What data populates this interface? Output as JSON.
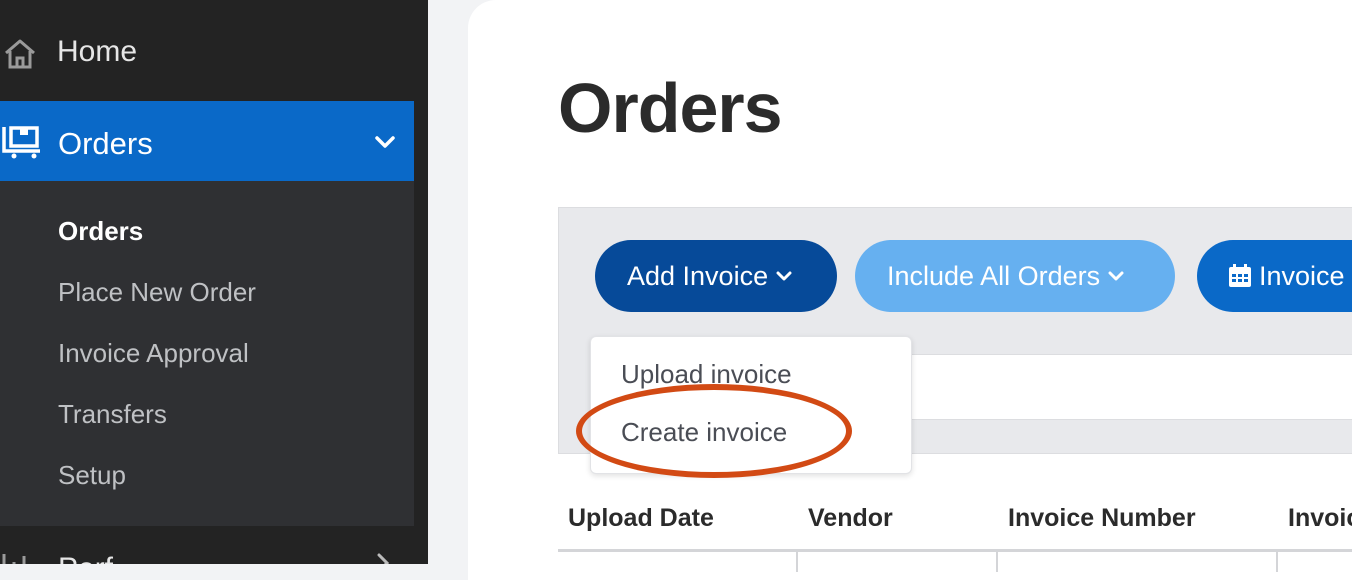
{
  "sidebar": {
    "home_label": "Home",
    "orders_label": "Orders",
    "sub_items": [
      "Orders",
      "Place New Order",
      "Invoice Approval",
      "Transfers",
      "Setup"
    ],
    "next_label": "Perf",
    "active_color": "#0a69c8"
  },
  "main": {
    "title": "Orders",
    "toolbar": {
      "add_invoice": "Add Invoice",
      "include_all_orders": "Include All Orders",
      "invoice_date": "Invoice"
    },
    "dropdown": {
      "items": [
        "Upload invoice",
        "Create invoice"
      ]
    },
    "table": {
      "headers": [
        "Upload Date",
        "Vendor",
        "Invoice Number",
        "Invoic"
      ]
    }
  },
  "icons": [
    "home-icon",
    "orders-icon",
    "chevron-down-icon",
    "calendar-icon",
    "caret-down-icon",
    "chart-icon",
    "chevron-right-icon"
  ],
  "colors": {
    "primary_dark": "#064a99",
    "primary": "#0a69c8",
    "primary_light": "#66b0f0",
    "annotation": "#d24a14"
  }
}
